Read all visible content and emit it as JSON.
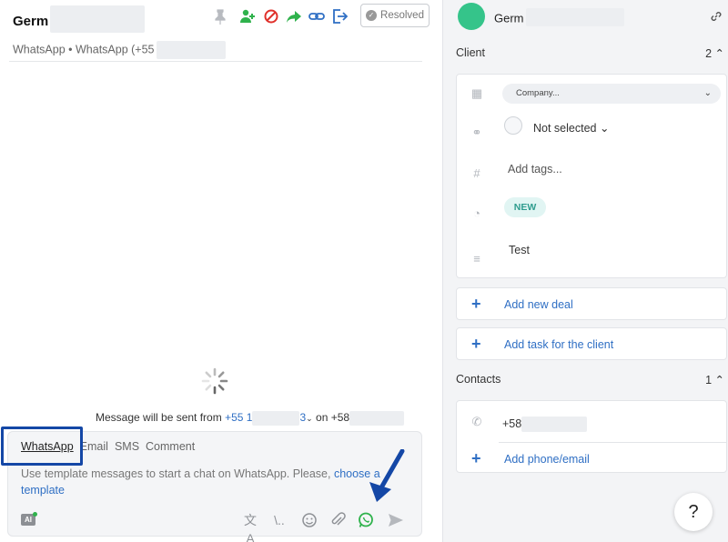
{
  "chat": {
    "contact_name": "Germ",
    "subtitle": "WhatsApp • WhatsApp (+55",
    "resolved_label": "Resolved",
    "send_prefix": "Message will be sent from",
    "send_phone": "+55 1",
    "send_phone_tail": "3",
    "send_on": "on",
    "send_to": "+58"
  },
  "composer": {
    "tabs": [
      "WhatsApp",
      "Email",
      "SMS",
      "Comment"
    ],
    "template_text": "Use template messages to start a chat on WhatsApp. Please,",
    "template_link": "choose a template",
    "ai_label": "AI"
  },
  "panel": {
    "name": "Germ",
    "client_title": "Client",
    "client_count": "2",
    "company_placeholder": "Company...",
    "responsible": "Not selected",
    "tags_placeholder": "Add tags...",
    "status": "NEW",
    "note": "Test",
    "add_deal": "Add new deal",
    "add_task": "Add task for the client",
    "contacts_title": "Contacts",
    "contacts_count": "1",
    "phone": "+58",
    "add_phone": "Add phone/email"
  },
  "help_label": "?",
  "colors": {
    "accent": "#2f6fc4",
    "green": "#2fb24c",
    "highlight": "#1447a6"
  },
  "icons": [
    "pin-icon",
    "add-user-icon",
    "block-icon",
    "forward-icon",
    "link-icon",
    "exit-icon",
    "spinner-icon",
    "translate-icon",
    "slash-icon",
    "emoji-icon",
    "attach-icon",
    "whatsapp-icon",
    "send-icon",
    "building-icon",
    "chain-icon",
    "hash-icon",
    "status-icon",
    "lines-icon",
    "phone-icon",
    "plus-icon"
  ]
}
